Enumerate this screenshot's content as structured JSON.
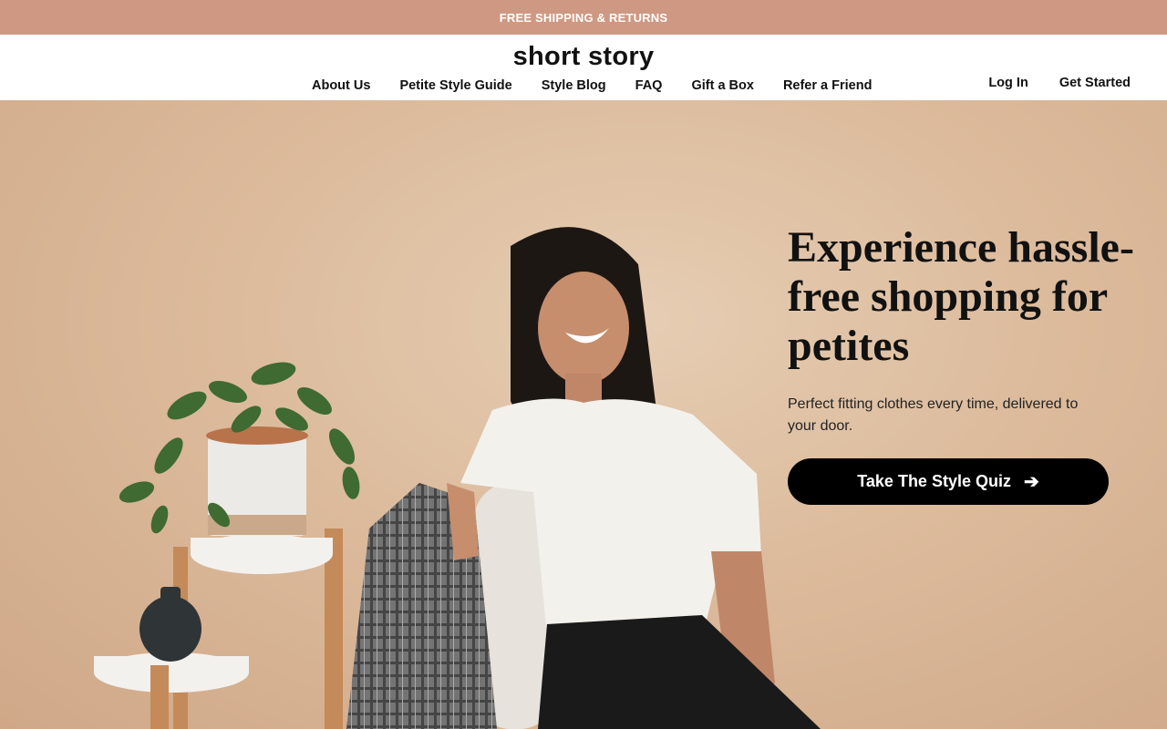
{
  "promo": {
    "text": "FREE SHIPPING & RETURNS"
  },
  "header": {
    "logo": "short story",
    "nav": [
      "About Us",
      "Petite Style Guide",
      "Style Blog",
      "FAQ",
      "Gift a Box",
      "Refer a Friend"
    ],
    "login": "Log In",
    "get_started": "Get Started"
  },
  "hero": {
    "headline": "Experience hassle-free shopping for petites",
    "subtext": "Perfect fitting clothes every time, delivered to your door.",
    "cta_label": "Take The Style Quiz",
    "cta_icon": "arrow-right-icon"
  },
  "colors": {
    "promo_bg": "#cf9882",
    "hero_bg": "#dcbb9c",
    "cta_bg": "#000000",
    "text": "#111111"
  }
}
